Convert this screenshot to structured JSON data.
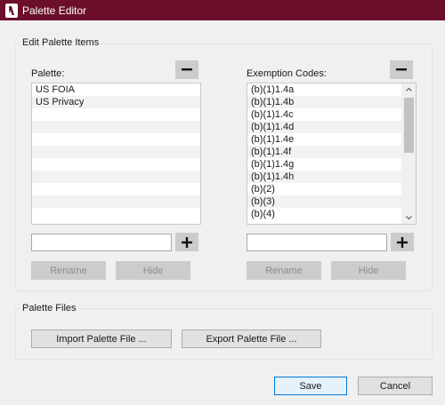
{
  "window": {
    "title": "Palette Editor"
  },
  "edit_group": {
    "label": "Edit Palette Items",
    "palette": {
      "label": "Palette:",
      "items": [
        "US FOIA",
        "US Privacy",
        "",
        "",
        "",
        "",
        "",
        "",
        "",
        "",
        ""
      ]
    },
    "exemption": {
      "label": "Exemption Codes:",
      "items": [
        "(b)(1)1.4a",
        "(b)(1)1.4b",
        "(b)(1)1.4c",
        "(b)(1)1.4d",
        "(b)(1)1.4e",
        "(b)(1)1.4f",
        "(b)(1)1.4g",
        "(b)(1)1.4h",
        "(b)(2)",
        "(b)(3)",
        "(b)(4)"
      ]
    },
    "rename_label": "Rename",
    "hide_label": "Hide",
    "palette_input_value": "",
    "exemption_input_value": ""
  },
  "files_group": {
    "label": "Palette Files",
    "import_label": "Import Palette File ...",
    "export_label": "Export Palette File ..."
  },
  "dialog": {
    "save_label": "Save",
    "cancel_label": "Cancel"
  },
  "colors": {
    "titlebar": "#6b0f2b",
    "accent": "#0078d7"
  }
}
